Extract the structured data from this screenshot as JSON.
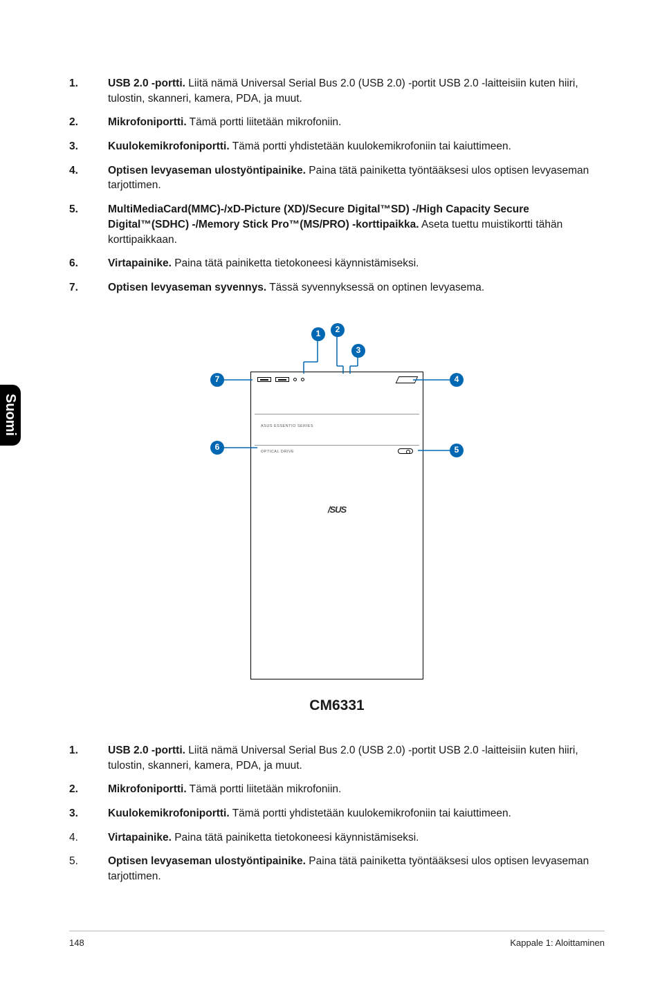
{
  "side_tab": "Suomi",
  "list_top": [
    {
      "num": "1.",
      "bold": "USB 2.0 -portti.",
      "text": " Liitä nämä Universal Serial Bus 2.0 (USB 2.0) -portit USB 2.0 -laitteisiin kuten hiiri, tulostin, skanneri, kamera, PDA, ja muut."
    },
    {
      "num": "2.",
      "bold": "Mikrofoniportti.",
      "text": " Tämä portti liitetään mikrofoniin."
    },
    {
      "num": "3.",
      "bold": "Kuulokemikrofoniportti.",
      "text": " Tämä portti yhdistetään kuulokemikrofoniin tai kaiuttimeen."
    },
    {
      "num": "4.",
      "bold": "Optisen levyaseman ulostyöntipainike.",
      "text": " Paina tätä painiketta työntääksesi ulos optisen levyaseman tarjottimen."
    },
    {
      "num": "5.",
      "bold": "MultiMediaCard(MMC)-/xD-Picture (XD)/Secure Digital™SD) -/High Capacity Secure Digital™(SDHC) -/Memory Stick Pro™(MS/PRO) -korttipaikka.",
      "text": " Aseta tuettu muistikortti tähän korttipaikkaan."
    },
    {
      "num": "6.",
      "bold": "Virtapainike.",
      "text": " Paina tätä painiketta tietokoneesi käynnistämiseksi."
    },
    {
      "num": "7.",
      "bold": "Optisen levyaseman syvennys.",
      "text": " Tässä syvennyksessä on optinen levyasema."
    }
  ],
  "diagram": {
    "label1": "ASUS ESSENTIO SERIES",
    "label2": "OPTICAL DRIVE",
    "logo": "/SUS",
    "model": "CM6331",
    "callouts": {
      "c1": "1",
      "c2": "2",
      "c3": "3",
      "c4": "4",
      "c5": "5",
      "c6": "6",
      "c7": "7"
    }
  },
  "list_bottom": [
    {
      "num": "1.",
      "bold": "USB 2.0 -portti.",
      "text": " Liitä nämä Universal Serial Bus 2.0 (USB 2.0) -portit USB 2.0 -laitteisiin kuten hiiri, tulostin, skanneri, kamera, PDA, ja muut."
    },
    {
      "num": "2.",
      "bold": "Mikrofoniportti.",
      "text": " Tämä portti liitetään mikrofoniin."
    },
    {
      "num": "3.",
      "bold": "Kuulokemikrofoniportti.",
      "text": " Tämä portti yhdistetään kuulokemikrofoniin tai kaiuttimeen."
    },
    {
      "num": "4.",
      "bold": "Virtapainike.",
      "text": " Paina tätä painiketta tietokoneesi käynnistämiseksi."
    },
    {
      "num": "5.",
      "bold": "Optisen levyaseman ulostyöntipainike.",
      "text": " Paina tätä painiketta työntääksesi ulos optisen levyaseman tarjottimen."
    }
  ],
  "footer": {
    "page": "148",
    "chapter": "Kappale 1: Aloittaminen"
  }
}
